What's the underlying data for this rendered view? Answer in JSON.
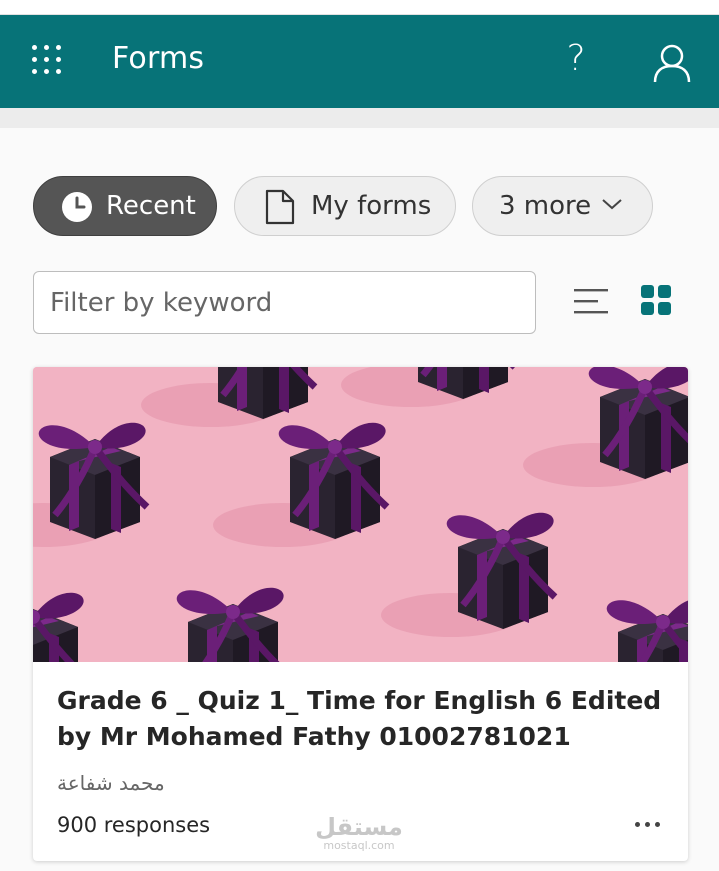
{
  "header": {
    "app_title": "Forms",
    "help_label": "?",
    "brand_color": "#077378",
    "icons": [
      "app-launcher-icon",
      "help-icon",
      "user-icon"
    ]
  },
  "tabs": [
    {
      "label": "Recent",
      "icon": "clock-icon",
      "selected": true
    },
    {
      "label": "My forms",
      "icon": "document-icon",
      "selected": false
    },
    {
      "label": "3 more",
      "icon": "chevron-down-icon",
      "selected": false
    }
  ],
  "filter": {
    "placeholder": "Filter by keyword",
    "value": ""
  },
  "view_toggle": {
    "list_icon": "list-view-icon",
    "grid_icon": "grid-view-icon",
    "active": "grid"
  },
  "card": {
    "title": "Grade 6 _ Quiz 1_ Time for English 6 Edited by Mr Mohamed Fathy 01002781021",
    "owner": "محمد شفاعة",
    "responses": "900 responses",
    "banner_colors": {
      "background": "#f2b3c3",
      "box": "#2a2330",
      "ribbon": "#6b1f78"
    }
  },
  "watermark": {
    "arabic": "مستقل",
    "latin": "mostaql.com"
  }
}
